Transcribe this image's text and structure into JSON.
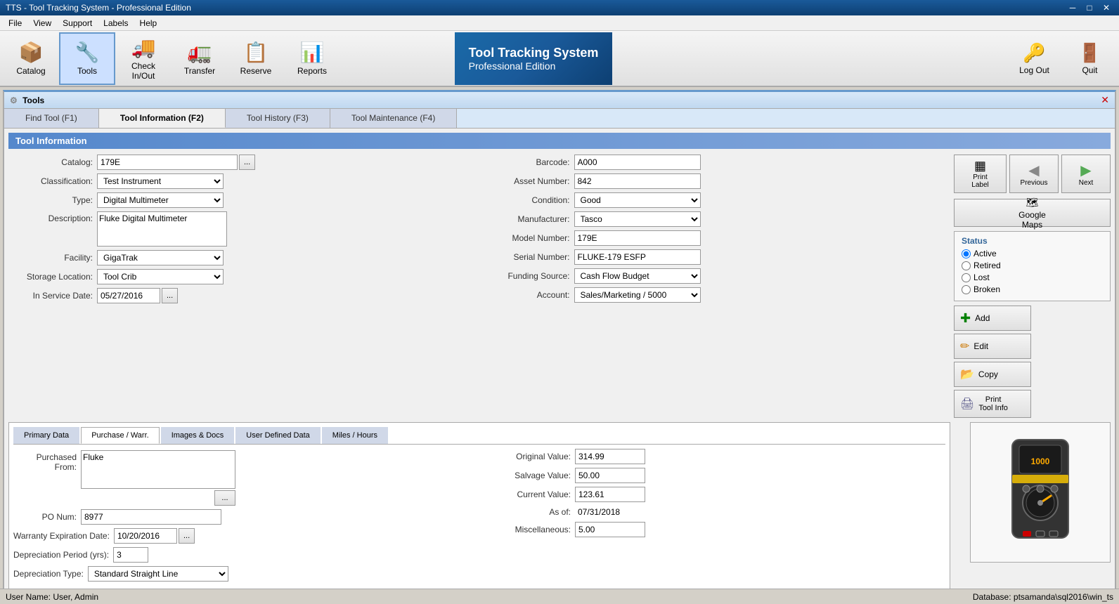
{
  "titleBar": {
    "title": "TTS - Tool Tracking System - Professional Edition",
    "minimize": "─",
    "restore": "□",
    "close": "✕"
  },
  "menuBar": {
    "items": [
      "File",
      "View",
      "Support",
      "Labels",
      "Help"
    ]
  },
  "toolbar": {
    "buttons": [
      {
        "id": "catalog",
        "label": "Catalog",
        "icon": "📦"
      },
      {
        "id": "tools",
        "label": "Tools",
        "icon": "🔧"
      },
      {
        "id": "checkinout",
        "label": "Check In/Out",
        "icon": "🚚"
      },
      {
        "id": "transfer",
        "label": "Transfer",
        "icon": "🚛"
      },
      {
        "id": "reserve",
        "label": "Reserve",
        "icon": "📋"
      },
      {
        "id": "reports",
        "label": "Reports",
        "icon": "📊"
      }
    ],
    "brand": {
      "line1": "Tool Tracking System",
      "line2": "Professional Edition"
    },
    "right": [
      {
        "id": "logout",
        "label": "Log Out",
        "icon": "🔑"
      },
      {
        "id": "quit",
        "label": "Quit",
        "icon": "🚪"
      }
    ]
  },
  "toolsWindow": {
    "title": "Tools",
    "closeBtn": "✕",
    "tabs": [
      {
        "id": "find",
        "label": "Find Tool (F1)",
        "active": false
      },
      {
        "id": "info",
        "label": "Tool Information (F2)",
        "active": true
      },
      {
        "id": "history",
        "label": "Tool History (F3)",
        "active": false
      },
      {
        "id": "maintenance",
        "label": "Tool Maintenance (F4)",
        "active": false
      }
    ],
    "sectionTitle": "Tool Information",
    "form": {
      "catalog": {
        "label": "Catalog:",
        "value": "179E"
      },
      "classification": {
        "label": "Classification:",
        "value": "Test Instrument"
      },
      "type": {
        "label": "Type:",
        "value": "Digital Multimeter"
      },
      "description": {
        "label": "Description:",
        "value": "Fluke Digital Multimeter"
      },
      "facility": {
        "label": "Facility:",
        "value": "GigaTrak"
      },
      "storageLocation": {
        "label": "Storage Location:",
        "value": "Tool Crib"
      },
      "inServiceDate": {
        "label": "In Service Date:",
        "value": "05/27/2016"
      },
      "barcode": {
        "label": "Barcode:",
        "value": "A000"
      },
      "assetNumber": {
        "label": "Asset Number:",
        "value": "842"
      },
      "condition": {
        "label": "Condition:",
        "value": "Good"
      },
      "manufacturer": {
        "label": "Manufacturer:",
        "value": "Tasco"
      },
      "modelNumber": {
        "label": "Model Number:",
        "value": "179E"
      },
      "serialNumber": {
        "label": "Serial Number:",
        "value": "FLUKE-179 ESFP"
      },
      "fundingSource": {
        "label": "Funding Source:",
        "value": "Cash Flow Budget"
      },
      "account": {
        "label": "Account:",
        "value": "Sales/Marketing / 5000"
      }
    },
    "status": {
      "title": "Status",
      "options": [
        "Active",
        "Retired",
        "Lost",
        "Broken"
      ],
      "selected": "Active"
    },
    "navButtons": {
      "previous": "Previous",
      "next": "Next"
    },
    "actionButtons": {
      "printLabel": "Print\nLabel",
      "googleMaps": "Google\nMaps",
      "add": "Add",
      "edit": "Edit",
      "copy": "Copy",
      "printToolInfo": "Print\nTool Info"
    },
    "subtabs": [
      {
        "id": "primary",
        "label": "Primary Data",
        "active": false
      },
      {
        "id": "purchase",
        "label": "Purchase / Warr.",
        "active": true
      },
      {
        "id": "images",
        "label": "Images & Docs",
        "active": false
      },
      {
        "id": "userdefined",
        "label": "User Defined Data",
        "active": false
      },
      {
        "id": "miles",
        "label": "Miles / Hours",
        "active": false
      }
    ],
    "purchaseForm": {
      "purchasedFrom": {
        "label": "Purchased\nFrom:",
        "value": "Fluke"
      },
      "poNum": {
        "label": "PO Num:",
        "value": "8977"
      },
      "warrantyExpDate": {
        "label": "Warranty Expiration Date:",
        "value": "10/20/2016"
      },
      "depPeriod": {
        "label": "Depreciation Period (yrs):",
        "value": "3"
      },
      "depType": {
        "label": "Depreciation Type:",
        "value": "Standard Straight Line"
      },
      "originalValue": {
        "label": "Original Value:",
        "value": "314.99"
      },
      "salvageValue": {
        "label": "Salvage Value:",
        "value": "50.00"
      },
      "currentValue": {
        "label": "Current Value:",
        "value": "123.61"
      },
      "asOf": {
        "label": "As of:",
        "value": "07/31/2018"
      },
      "miscellaneous": {
        "label": "Miscellaneous:",
        "value": "5.00"
      }
    }
  },
  "statusBar": {
    "user": "User Name:  User, Admin",
    "database": "Database:  ptsamanda\\sql2016\\win_ts"
  }
}
